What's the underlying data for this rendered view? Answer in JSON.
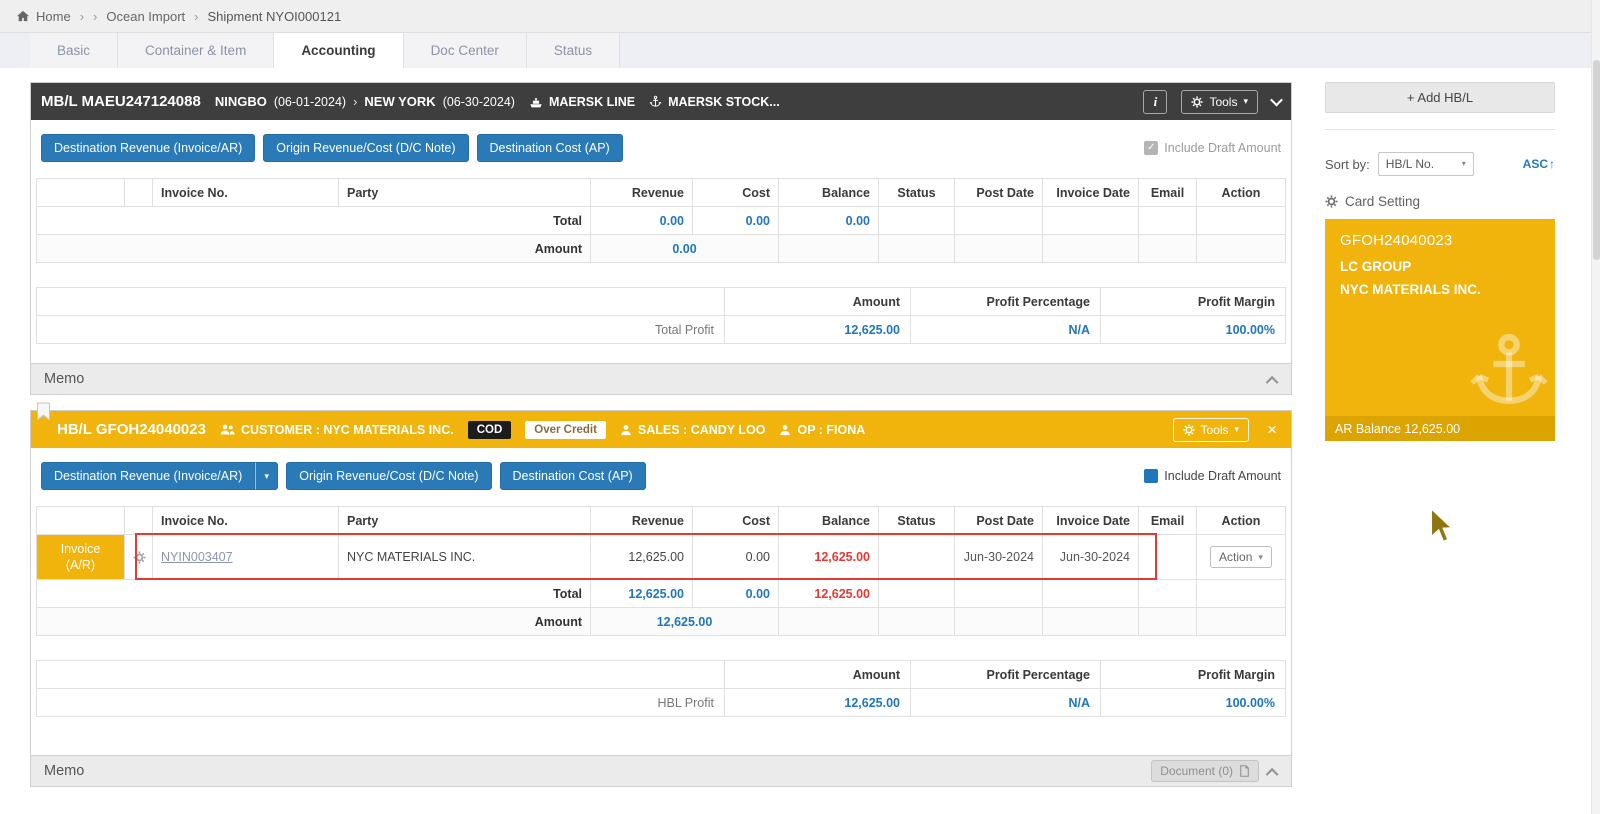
{
  "breadcrumb": {
    "home_label": "Home",
    "separator": "›",
    "items": [
      "Ocean Import",
      "Shipment NYOI000121"
    ]
  },
  "tabs": [
    {
      "label": "Basic",
      "active": false
    },
    {
      "label": "Container & Item",
      "active": false
    },
    {
      "label": "Accounting",
      "active": true
    },
    {
      "label": "Doc Center",
      "active": false
    },
    {
      "label": "Status",
      "active": false
    }
  ],
  "columns": [
    "",
    "",
    "Invoice No.",
    "Party",
    "Revenue",
    "Cost",
    "Balance",
    "Status",
    "Post Date",
    "Invoice Date",
    "Email",
    "Action"
  ],
  "profit_columns": [
    "Amount",
    "Profit Percentage",
    "Profit Margin"
  ],
  "mbl": {
    "title": "MB/L MAEU247124088",
    "origin": "NINGBO",
    "origin_date": "(06-01-2024)",
    "dest": "NEW YORK",
    "dest_date": "(06-30-2024)",
    "carrier": "MAERSK LINE",
    "stock": "MAERSK STOCK...",
    "info_label": "i",
    "tools_label": "Tools",
    "buttons": [
      "Destination Revenue (Invoice/AR)",
      "Origin Revenue/Cost (D/C Note)",
      "Destination Cost (AP)"
    ],
    "include_draft": "Include Draft Amount",
    "table": {
      "total_label": "Total",
      "total": {
        "revenue": "0.00",
        "cost": "0.00",
        "balance": "0.00"
      },
      "amount_label": "Amount",
      "amount_value": "0.00"
    },
    "profit": {
      "label": "Total Profit",
      "amount": "12,625.00",
      "percentage": "N/A",
      "margin": "100.00%"
    },
    "memo_label": "Memo"
  },
  "hbl": {
    "title": "HB/L GFOH24040023",
    "customer": "CUSTOMER : NYC MATERIALS INC.",
    "badges": [
      "COD",
      "Over Credit"
    ],
    "sales": "SALES : CANDY LOO",
    "op": "OP : FIONA",
    "tools_label": "Tools",
    "buttons": [
      "Destination Revenue (Invoice/AR)",
      "Origin Revenue/Cost (D/C Note)",
      "Destination Cost (AP)"
    ],
    "include_draft": "Include Draft Amount",
    "row": {
      "type_line1": "Invoice",
      "type_line2": "(A/R)",
      "invoice_no": "NYIN003407",
      "party": "NYC MATERIALS INC.",
      "revenue": "12,625.00",
      "cost": "0.00",
      "balance": "12,625.00",
      "status": "",
      "post_date": "Jun-30-2024",
      "invoice_date": "Jun-30-2024",
      "email": "",
      "action_label": "Action"
    },
    "table": {
      "total_label": "Total",
      "total": {
        "revenue": "12,625.00",
        "cost": "0.00",
        "balance": "12,625.00"
      },
      "amount_label": "Amount",
      "amount_value": "12,625.00"
    },
    "profit": {
      "label": "HBL Profit",
      "amount": "12,625.00",
      "percentage": "N/A",
      "margin": "100.00%"
    },
    "memo_label": "Memo",
    "document_button": "Document (0)"
  },
  "sidebar": {
    "add_label": "+ Add HB/L",
    "sort_label": "Sort by:",
    "sort_value": "HB/L No.",
    "sort_dir": "ASC",
    "card_setting": "Card Setting",
    "card": {
      "number": "GFOH24040023",
      "group": "LC GROUP",
      "customer": "NYC MATERIALS INC.",
      "ar_balance": "AR Balance 12,625.00"
    }
  },
  "colors": {
    "brand_amber": "#f0b40c",
    "amber_dark": "#dca400",
    "button_blue": "#2b7ab8",
    "number_blue": "#1f76bb",
    "balance_red": "#e53935",
    "dark_header": "#3e3e3e",
    "teal_accent": "#00b3a6"
  },
  "icons": [
    "home-icon",
    "chevron-right-icon",
    "ship-icon",
    "anchor-icon",
    "info-icon",
    "gear-icon",
    "people-icon",
    "person-icon",
    "close-icon",
    "check-icon",
    "document-icon",
    "arrow-up-icon",
    "bookmark-icon",
    "mouse-cursor"
  ]
}
